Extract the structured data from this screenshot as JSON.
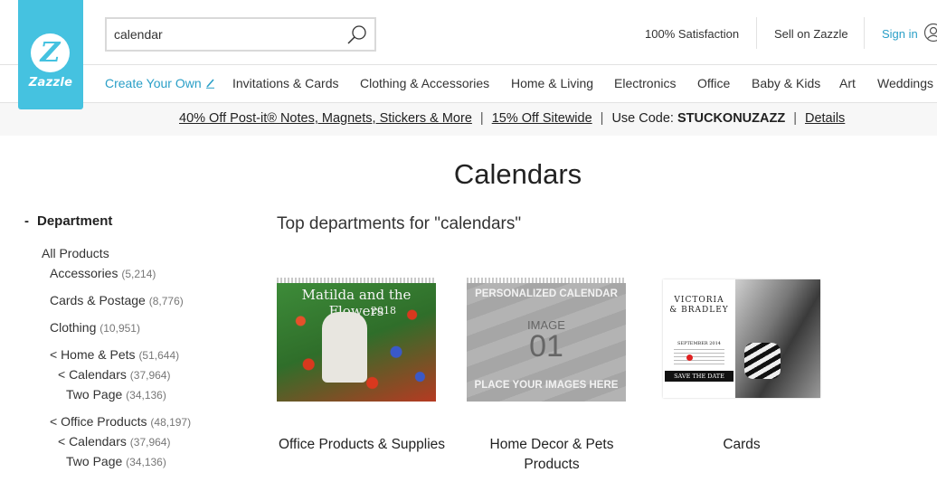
{
  "brand": {
    "name": "Zazzle",
    "logo_letter": "Z",
    "accent": "#45c2e0",
    "link_color": "#2a9fc7"
  },
  "search": {
    "value": "calendar",
    "placeholder": ""
  },
  "utility": {
    "satisfaction": "100% Satisfaction",
    "sell": "Sell on Zazzle",
    "signin": "Sign in"
  },
  "nav": {
    "create": "Create Your Own",
    "items": [
      "Invitations & Cards",
      "Clothing & Accessories",
      "Home & Living",
      "Electronics",
      "Office",
      "Baby & Kids",
      "Art",
      "Weddings"
    ]
  },
  "promo": {
    "offer1": "40% Off Post-it® Notes, Magnets, Stickers & More",
    "offer2": "15% Off Sitewide",
    "code_label": "Use Code:",
    "code": "STUCKONUZAZZ",
    "details": "Details",
    "separator": "|"
  },
  "page": {
    "title": "Calendars",
    "subheading": "Top departments for \"calendars\""
  },
  "sidebar": {
    "heading": "Department",
    "collapse_symbol": "-",
    "all": "All Products",
    "facets": [
      {
        "label": "Accessories",
        "count": "(5,214)"
      },
      {
        "label": "Cards & Postage",
        "count": "(8,776)"
      },
      {
        "label": "Clothing",
        "count": "(10,951)"
      },
      {
        "label": "< Home & Pets",
        "count": "(51,644)"
      },
      {
        "label": "< Calendars",
        "count": "(37,964)"
      },
      {
        "label": "Two Page",
        "count": "(34,136)"
      },
      {
        "label": "< Office Products",
        "count": "(48,197)"
      },
      {
        "label": "< Calendars",
        "count": "(37,964)"
      },
      {
        "label": "Two Page",
        "count": "(34,136)"
      }
    ]
  },
  "departments": [
    {
      "label": "Office Products & Supplies",
      "image_title": "Matilda and the Flowers",
      "image_year": "2018"
    },
    {
      "label": "Home Decor & Pets Products",
      "image_top": "PERSONALIZED CALENDAR",
      "image_mid1": "IMAGE",
      "image_mid2": "01",
      "image_bottom": "PLACE YOUR IMAGES HERE"
    },
    {
      "label": "Cards",
      "image_name1": "VICTORIA",
      "image_name2": "& BRADLEY",
      "image_month": "SEPTEMBER 2014",
      "image_save": "SAVE THE DATE"
    }
  ]
}
